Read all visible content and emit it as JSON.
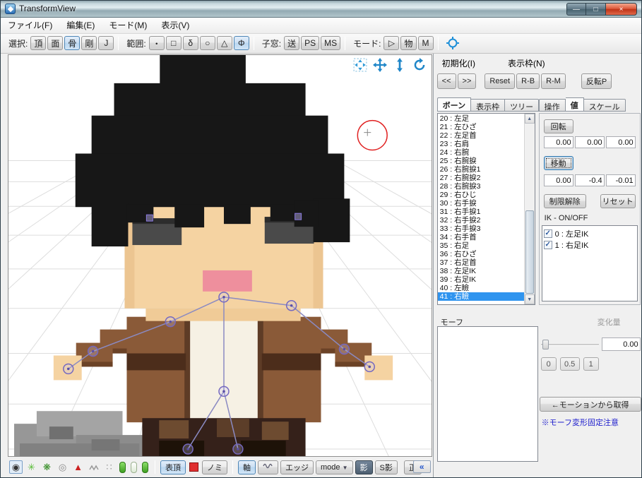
{
  "window": {
    "title": "TransformView"
  },
  "titlebar": {
    "minimize": "—",
    "maximize": "□",
    "close": "×"
  },
  "menu": {
    "items": [
      "ファイル(F)",
      "編集(E)",
      "モード(M)",
      "表示(V)"
    ]
  },
  "toolbar": {
    "select_label": "選択:",
    "select": [
      "頂",
      "面",
      "骨",
      "剛",
      "J"
    ],
    "range_label": "範囲:",
    "range": [
      "・",
      "□",
      "δ",
      "○",
      "△",
      "Φ"
    ],
    "child_label": "子窓:",
    "child": [
      "送",
      "PS",
      "MS"
    ],
    "mode_label": "モード:",
    "mode": [
      "▷",
      "物",
      "M"
    ]
  },
  "panel": {
    "menu": {
      "init": "初期化(I)",
      "frame": "表示枠(N)"
    },
    "nav": {
      "prev": "<<",
      "next": ">>",
      "reset": "Reset",
      "rb": "R-B",
      "rm": "R-M",
      "invert": "反転P"
    },
    "left_tabs": [
      "ボーン",
      "表示枠",
      "ツリー"
    ],
    "right_tabs": [
      "操作",
      "値",
      "スケール"
    ],
    "values": {
      "rotate_label": "回転",
      "rotate": [
        "0.00",
        "0.00",
        "0.00"
      ],
      "move_label": "移動",
      "move": [
        "0.00",
        "-0.4",
        "-0.01"
      ],
      "unlock": "制限解除",
      "reset": "リセット",
      "ik_label": "IK - ON/OFF",
      "ik_items": [
        "0 : 左足IK",
        "1 : 右足IK"
      ]
    },
    "morph": {
      "label": "モーフ",
      "amount_label": "変化量",
      "amount_value": "0.00",
      "quick": [
        "0",
        "0.5",
        "1"
      ],
      "get_button": "←モーションから取得",
      "note": "※モーフ変形固定注意"
    }
  },
  "bone_list": {
    "items": [
      "20 : 左足",
      "21 : 左ひざ",
      "22 : 左足首",
      "23 : 右肩",
      "24 : 右腕",
      "25 : 右腕捩",
      "26 : 右腕捩1",
      "27 : 右腕捩2",
      "28 : 右腕捩3",
      "29 : 右ひじ",
      "30 : 右手捩",
      "31 : 右手捩1",
      "32 : 右手捩2",
      "33 : 右手捩3",
      "34 : 右手首",
      "35 : 右足",
      "36 : 右ひざ",
      "37 : 右足首",
      "38 : 左足IK",
      "39 : 右足IK",
      "40 : 左瞼",
      "41 : 右瞼"
    ],
    "selected_index": 21
  },
  "bottom_bar": {
    "vertex_toggle": "表頂",
    "nomi_toggle": "ノミ",
    "axis_toggle": "軸",
    "edge_toggle": "エッジ",
    "mode_dropdown": "mode",
    "shadow_toggle": "影",
    "self_shadow_toggle": "S影",
    "front_toggle": "正"
  },
  "icons": {
    "up_arrow": "▲",
    "down_arrow": "▼",
    "collapse": "«",
    "check": "✓",
    "filled_circle": "◉",
    "sparkle": "✳",
    "flower": "❋",
    "double_circle": "◎",
    "red_triangle": "▲",
    "dots": "∷",
    "dropdown_arrow": "▼"
  },
  "colors": {
    "selection_blue": "#2f94ef",
    "note_blue": "#1c1ccc",
    "cursor_red": "#e02020"
  }
}
